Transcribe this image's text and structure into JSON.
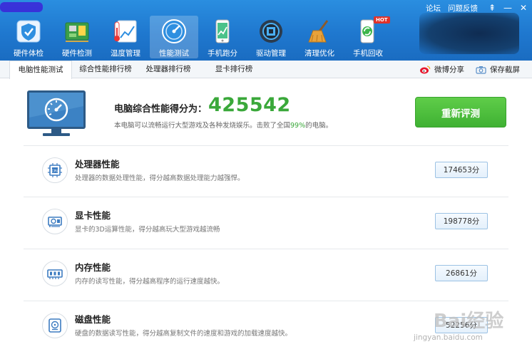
{
  "top_links": {
    "forum": "论坛",
    "feedback": "问题反馈",
    "pin": "⇞",
    "minimize": "—",
    "close": "✕"
  },
  "nav": [
    {
      "label": "硬件体检",
      "icon": "shield-check-icon",
      "active": false
    },
    {
      "label": "硬件检测",
      "icon": "circuit-board-icon",
      "active": false
    },
    {
      "label": "温度管理",
      "icon": "thermometer-icon",
      "active": false
    },
    {
      "label": "性能测试",
      "icon": "speedometer-icon",
      "active": true
    },
    {
      "label": "手机跑分",
      "icon": "phone-chart-icon",
      "active": false
    },
    {
      "label": "驱动管理",
      "icon": "gear-chip-icon",
      "active": false
    },
    {
      "label": "清理优化",
      "icon": "broom-icon",
      "active": false
    },
    {
      "label": "手机回收",
      "icon": "phone-recycle-icon",
      "active": false
    }
  ],
  "hot_badge": "HOT",
  "tabs": [
    {
      "label": "电脑性能测试",
      "active": true
    },
    {
      "label": "综合性能排行榜",
      "active": false
    },
    {
      "label": "处理器排行榜",
      "active": false
    },
    {
      "label": "显卡排行榜",
      "active": false
    }
  ],
  "actions": {
    "weibo_share": "微博分享",
    "save_screenshot": "保存截屏"
  },
  "score": {
    "title": "电脑综合性能得分为：",
    "value": "425542",
    "desc_before": "本电脑可以流畅运行大型游戏及各种发烧娱乐。击败了全国",
    "percent": "99%",
    "desc_after": "的电脑。",
    "retest_label": "重新评测"
  },
  "items": [
    {
      "title": "处理器性能",
      "desc": "处理器的数据处理性能，得分越高数据处理能力越强悍。",
      "score": "174653分",
      "icon": "cpu-icon"
    },
    {
      "title": "显卡性能",
      "desc": "显卡的3D运算性能，得分越高玩大型游戏越流畅",
      "score": "198778分",
      "icon": "graphics-card-icon"
    },
    {
      "title": "内存性能",
      "desc": "内存的读写性能，得分越高程序的运行速度越快。",
      "score": "26861分",
      "icon": "memory-icon"
    },
    {
      "title": "磁盘性能",
      "desc": "硬盘的数据读写性能，得分越高复制文件的速度和游戏的加载速度越快。",
      "score": "52256分",
      "icon": "disk-icon"
    }
  ],
  "watermark": {
    "text": "Bai经验",
    "sub": "jingyan.baidu.com"
  },
  "colors": {
    "header": "#1f78cf",
    "accent_green": "#3aa83a",
    "button_green": "#4cbe3c"
  }
}
